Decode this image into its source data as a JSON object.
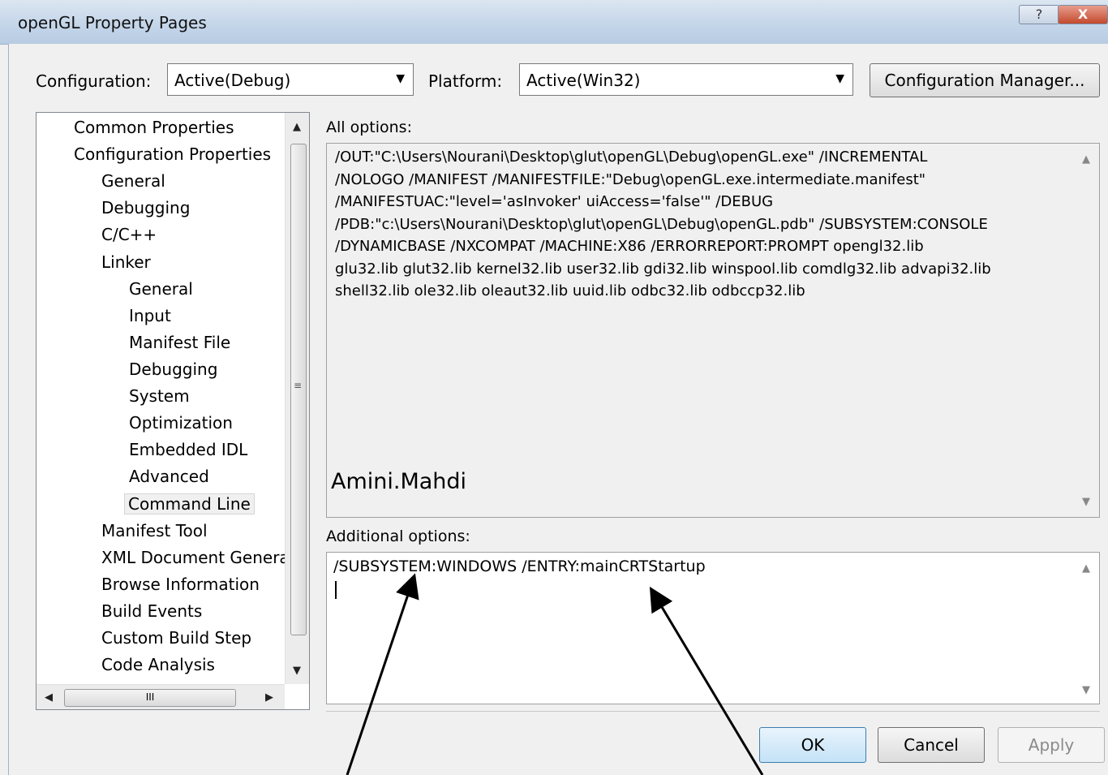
{
  "window": {
    "title": "openGL Property Pages",
    "help_glyph": "?",
    "close_glyph": "X"
  },
  "config": {
    "configuration_label": "Configuration:",
    "configuration_value": "Active(Debug)",
    "platform_label": "Platform:",
    "platform_value": "Active(Win32)",
    "config_manager_button": "Configuration Manager..."
  },
  "tree": {
    "items": [
      {
        "label": "Common Properties",
        "level": 0
      },
      {
        "label": "Configuration Properties",
        "level": 0
      },
      {
        "label": "General",
        "level": 1
      },
      {
        "label": "Debugging",
        "level": 1
      },
      {
        "label": "C/C++",
        "level": 1
      },
      {
        "label": "Linker",
        "level": 1
      },
      {
        "label": "General",
        "level": 2
      },
      {
        "label": "Input",
        "level": 2
      },
      {
        "label": "Manifest File",
        "level": 2
      },
      {
        "label": "Debugging",
        "level": 2
      },
      {
        "label": "System",
        "level": 2
      },
      {
        "label": "Optimization",
        "level": 2
      },
      {
        "label": "Embedded IDL",
        "level": 2
      },
      {
        "label": "Advanced",
        "level": 2
      },
      {
        "label": "Command Line",
        "level": 2,
        "selected": true
      },
      {
        "label": "Manifest Tool",
        "level": 1
      },
      {
        "label": "XML Document Genera",
        "level": 1
      },
      {
        "label": "Browse Information",
        "level": 1
      },
      {
        "label": "Build Events",
        "level": 1
      },
      {
        "label": "Custom Build Step",
        "level": 1
      },
      {
        "label": "Code Analysis",
        "level": 1
      }
    ],
    "hscroll_thumb_glyph": "III"
  },
  "all_options": {
    "label": "All options:",
    "lines": [
      "/OUT:\"C:\\Users\\Nourani\\Desktop\\glut\\openGL\\Debug\\openGL.exe\" /INCREMENTAL",
      "/NOLOGO /MANIFEST /MANIFESTFILE:\"Debug\\openGL.exe.intermediate.manifest\"",
      "/MANIFESTUAC:\"level='asInvoker' uiAccess='false'\" /DEBUG",
      "/PDB:\"c:\\Users\\Nourani\\Desktop\\glut\\openGL\\Debug\\openGL.pdb\" /SUBSYSTEM:CONSOLE",
      "/DYNAMICBASE /NXCOMPAT /MACHINE:X86 /ERRORREPORT:PROMPT opengl32.lib",
      "glu32.lib  glut32.lib  kernel32.lib user32.lib gdi32.lib winspool.lib comdlg32.lib advapi32.lib",
      "shell32.lib ole32.lib oleaut32.lib uuid.lib odbc32.lib odbccp32.lib"
    ]
  },
  "annotation": {
    "author": "Amini.Mahdi"
  },
  "additional_options": {
    "label": "Additional options:",
    "value": "/SUBSYSTEM:WINDOWS   /ENTRY:mainCRTStartup"
  },
  "buttons": {
    "ok": "OK",
    "cancel": "Cancel",
    "apply": "Apply"
  },
  "icons": {
    "dropdown": "chevron-down-icon",
    "scroll_up": "arrow-up-icon",
    "scroll_down": "arrow-down-icon",
    "grip": "grip-icon"
  }
}
